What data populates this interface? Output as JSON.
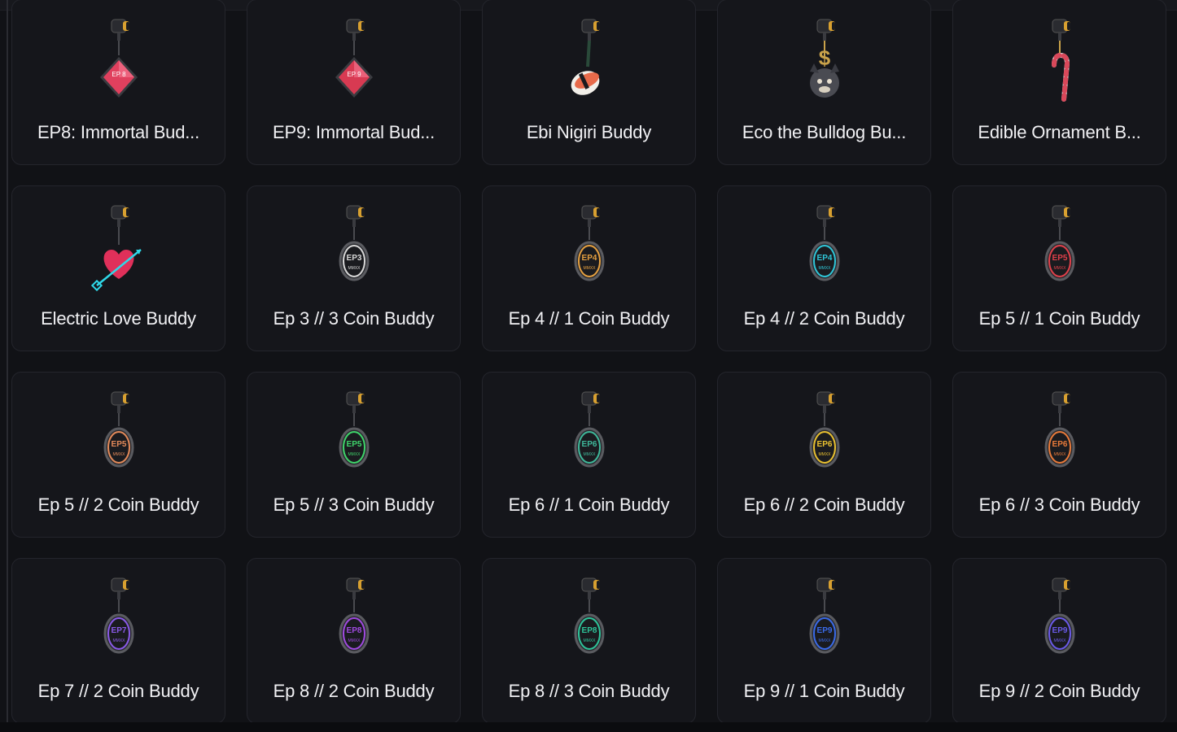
{
  "grid": {
    "items": [
      {
        "name": "EP8: Immortal Bud...",
        "icon": "ep8-immortal-diamond-icon",
        "kind": "diamond",
        "color": "#e0405e",
        "tag": "EP 8"
      },
      {
        "name": "EP9: Immortal Bud...",
        "icon": "ep9-immortal-diamond-icon",
        "kind": "diamond",
        "color": "#d83a52",
        "tag": "EP 9"
      },
      {
        "name": "Ebi Nigiri Buddy",
        "icon": "sushi-icon",
        "kind": "sushi",
        "color": "#e86a4a",
        "tag": ""
      },
      {
        "name": "Eco the Bulldog Bu...",
        "icon": "bulldog-icon",
        "kind": "bulldog",
        "color": "#c9a24a",
        "tag": ""
      },
      {
        "name": "Edible Ornament B...",
        "icon": "candy-cane-icon",
        "kind": "candy",
        "color": "#d9485a",
        "tag": ""
      },
      {
        "name": "Electric Love Buddy",
        "icon": "heart-arrow-icon",
        "kind": "heart",
        "color": "#e0305a",
        "tag": ""
      },
      {
        "name": "Ep 3 // 3 Coin Buddy",
        "icon": "coin-icon",
        "kind": "coin",
        "color": "#d8d8d8",
        "tag": "EP3"
      },
      {
        "name": "Ep 4 // 1 Coin Buddy",
        "icon": "coin-icon",
        "kind": "coin",
        "color": "#e5a040",
        "tag": "EP4"
      },
      {
        "name": "Ep 4 // 2 Coin Buddy",
        "icon": "coin-icon",
        "kind": "coin",
        "color": "#2fc6d8",
        "tag": "EP4"
      },
      {
        "name": "Ep 5 // 1 Coin Buddy",
        "icon": "coin-icon",
        "kind": "coin",
        "color": "#e0404a",
        "tag": "EP5"
      },
      {
        "name": "Ep 5 // 2 Coin Buddy",
        "icon": "coin-icon",
        "kind": "coin",
        "color": "#e38a5a",
        "tag": "EP5"
      },
      {
        "name": "Ep 5 // 3 Coin Buddy",
        "icon": "coin-icon",
        "kind": "coin",
        "color": "#3fd46a",
        "tag": "EP5"
      },
      {
        "name": "Ep 6 // 1 Coin Buddy",
        "icon": "coin-icon",
        "kind": "coin",
        "color": "#3fb89a",
        "tag": "EP6"
      },
      {
        "name": "Ep 6 // 2 Coin Buddy",
        "icon": "coin-icon",
        "kind": "coin",
        "color": "#e8c030",
        "tag": "EP6"
      },
      {
        "name": "Ep 6 // 3 Coin Buddy",
        "icon": "coin-icon",
        "kind": "coin",
        "color": "#e87a3a",
        "tag": "EP6"
      },
      {
        "name": "Ep 7 // 2 Coin Buddy",
        "icon": "coin-icon",
        "kind": "coin",
        "color": "#8a5ae8",
        "tag": "EP7"
      },
      {
        "name": "Ep 8 // 2 Coin Buddy",
        "icon": "coin-icon",
        "kind": "coin",
        "color": "#a04ae0",
        "tag": "EP8"
      },
      {
        "name": "Ep 8 // 3 Coin Buddy",
        "icon": "coin-icon",
        "kind": "coin",
        "color": "#2ec49a",
        "tag": "EP8"
      },
      {
        "name": "Ep 9 // 1 Coin Buddy",
        "icon": "coin-icon",
        "kind": "coin",
        "color": "#3a6ae8",
        "tag": "EP9"
      },
      {
        "name": "Ep 9 // 2 Coin Buddy",
        "icon": "coin-icon",
        "kind": "coin",
        "color": "#6a5ae8",
        "tag": "EP9"
      }
    ]
  }
}
